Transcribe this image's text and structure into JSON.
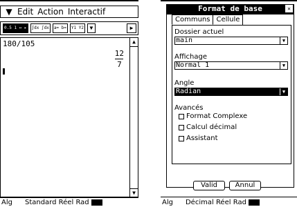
{
  "left": {
    "menu": {
      "items": [
        "Edit",
        "Action",
        "Interactif"
      ]
    },
    "toolbar": {
      "btn1": "0.5 1 ↔ ▸",
      "btn2": "∫dx ∫dx",
      "btn3": "a= b=",
      "btn4": "Y1 Y2"
    },
    "work": {
      "expression": "180/105",
      "numerator": "12",
      "denominator": "7"
    },
    "status": {
      "mode": "Alg",
      "format": "Standard",
      "domain": "Réel",
      "angle": "Rad"
    }
  },
  "right": {
    "title": "Format de base",
    "tabs": [
      "Communs",
      "Cellule"
    ],
    "folder_label": "Dossier actuel",
    "folder_value": "main",
    "display_label": "Affichage",
    "display_value": "Normal 1",
    "angle_label": "Angle",
    "angle_value": "Radian",
    "advanced_label": "Avancés",
    "options": [
      "Format Complexe",
      "Calcul décimal",
      "Assistant"
    ],
    "ok_label": "Valid",
    "cancel_label": "Annul",
    "status": {
      "mode": "Alg",
      "format": "Décimal",
      "domain": "Réel",
      "angle": "Rad"
    }
  }
}
